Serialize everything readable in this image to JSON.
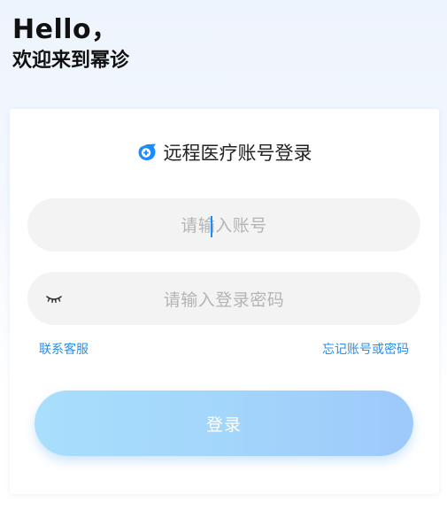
{
  "greeting": {
    "hello": "Hello，",
    "welcome": "欢迎来到幂诊"
  },
  "card": {
    "title": "远程医疗账号登录",
    "title_icon": "doctor-logo-icon",
    "account_placeholder_before_caret": "请输",
    "account_placeholder_after_caret": "入账号",
    "password_placeholder": "请输入登录密码",
    "password_toggle_icon": "eye-closed-icon",
    "contact_service": "联系客服",
    "forgot": "忘记账号或密码",
    "login_button": "登录"
  },
  "colors": {
    "accent": "#2b8ee8",
    "button_start": "#a9defc",
    "button_end": "#9ec9fb",
    "input_bg": "#f3f3f3",
    "caret": "#1a8cff"
  }
}
